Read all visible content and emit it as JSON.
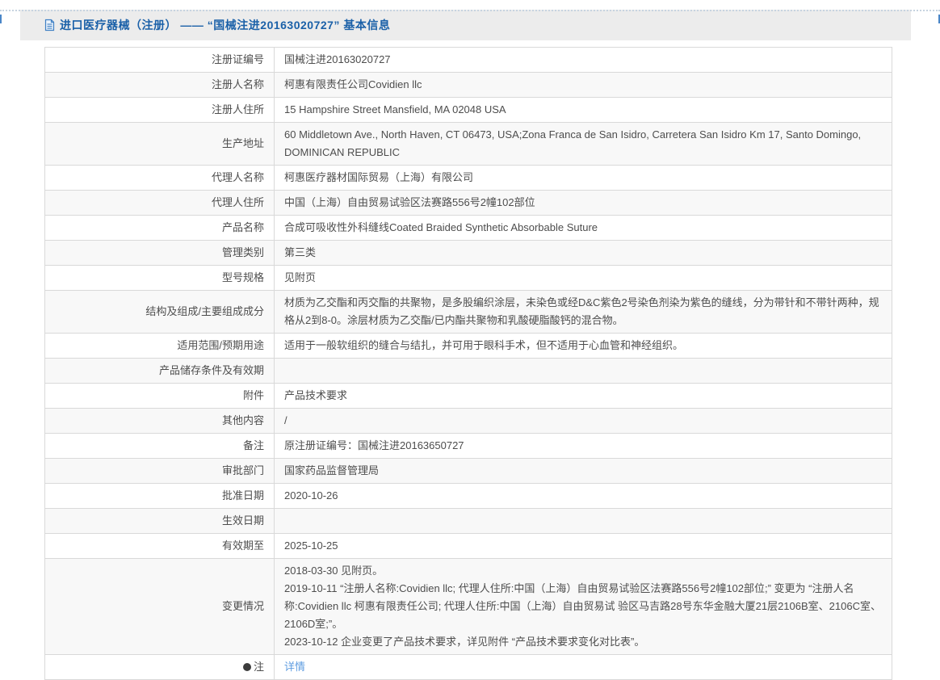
{
  "colors": {
    "header_text": "#1a60a8",
    "header_bar_bg": "#ececec",
    "link": "#5e9ce0",
    "table_border": "#d9d9d9",
    "alt_row_bg": "#f8f8f8"
  },
  "header": {
    "icon": "document-icon",
    "title": "进口医疗器械（注册） —— “国械注进20163020727” 基本信息"
  },
  "table": {
    "rows": [
      {
        "label": "注册证编号",
        "value": "国械注进20163020727"
      },
      {
        "label": "注册人名称",
        "value": "柯惠有限责任公司Covidien llc"
      },
      {
        "label": "注册人住所",
        "value": "15 Hampshire Street Mansfield, MA 02048 USA"
      },
      {
        "label": "生产地址",
        "value": "60 Middletown Ave., North Haven, CT 06473, USA;Zona Franca de San Isidro, Carretera San Isidro Km 17, Santo Domingo, DOMINICAN REPUBLIC"
      },
      {
        "label": "代理人名称",
        "value": "柯惠医疗器材国际贸易（上海）有限公司"
      },
      {
        "label": "代理人住所",
        "value": "中国（上海）自由贸易试验区法赛路556号2幢102部位"
      },
      {
        "label": "产品名称",
        "value": "合成可吸收性外科缝线Coated Braided Synthetic Absorbable Suture"
      },
      {
        "label": "管理类别",
        "value": "第三类"
      },
      {
        "label": "型号规格",
        "value": "见附页"
      },
      {
        "label": "结构及组成/主要组成成分",
        "value": "材质为乙交酯和丙交酯的共聚物，是多股编织涂层，未染色或经D&C紫色2号染色剂染为紫色的缝线，分为带针和不带针两种，规格从2到8-0。涂层材质为乙交酯/已内酯共聚物和乳酸硬脂酸钙的混合物。"
      },
      {
        "label": "适用范围/预期用途",
        "value": "适用于一般软组织的缝合与结扎，并可用于眼科手术，但不适用于心血管和神经组织。"
      },
      {
        "label": "产品储存条件及有效期",
        "value": ""
      },
      {
        "label": "附件",
        "value": "产品技术要求"
      },
      {
        "label": "其他内容",
        "value": "/"
      },
      {
        "label": "备注",
        "value": "原注册证编号：国械注进20163650727"
      },
      {
        "label": "审批部门",
        "value": "国家药品监督管理局"
      },
      {
        "label": "批准日期",
        "value": "2020-10-26"
      },
      {
        "label": "生效日期",
        "value": ""
      },
      {
        "label": "有效期至",
        "value": "2025-10-25"
      },
      {
        "label": "变更情况",
        "value": "2018-03-30 见附页。\n2019-10-11 “注册人名称:Covidien llc; 代理人住所:中国（上海）自由贸易试验区法赛路556号2幢102部位;” 变更为 “注册人名称:Covidien llc 柯惠有限责任公司; 代理人住所:中国（上海）自由贸易试 验区马吉路28号东华金融大厦21层2106B室、2106C室、2106D室;”。\n2023-10-12 企业变更了产品技术要求，详见附件 “产品技术要求变化对比表”。"
      },
      {
        "label": "注",
        "label_icon": "note-icon",
        "value": "详情",
        "link": true
      }
    ]
  }
}
